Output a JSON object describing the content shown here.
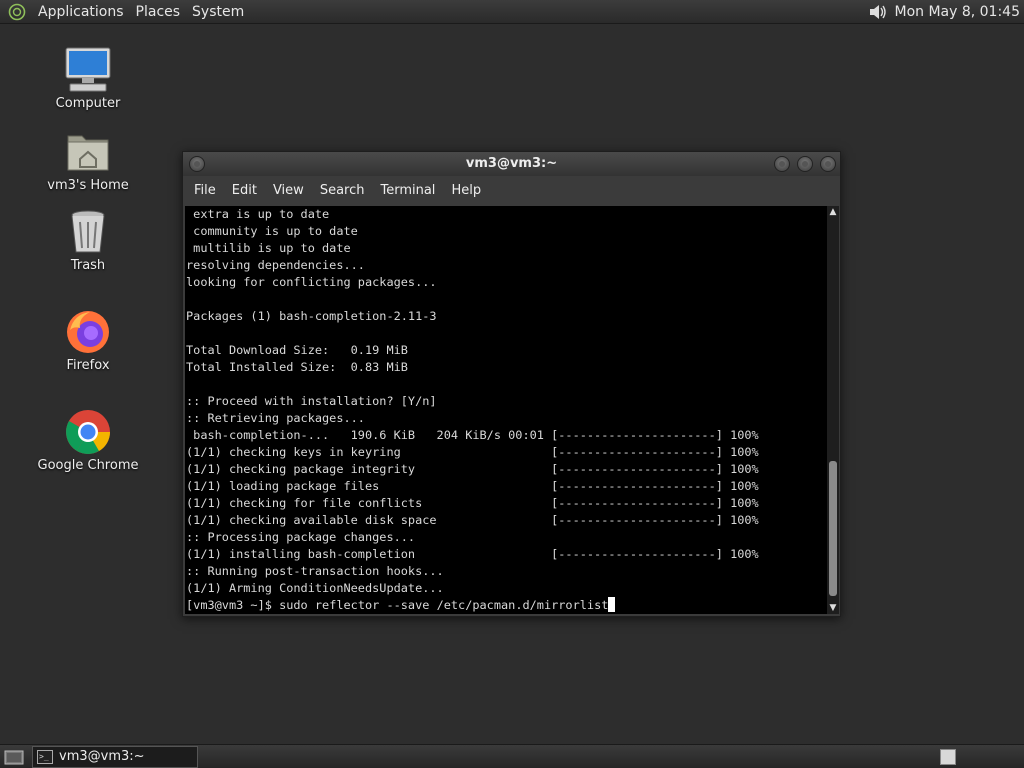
{
  "top_panel": {
    "menus": [
      "Applications",
      "Places",
      "System"
    ],
    "clock": "Mon May  8, 01:45",
    "icons": {
      "logo": "distro-logo-icon",
      "volume": "volume-icon"
    }
  },
  "desktop": {
    "icons": [
      {
        "label": "Computer",
        "icon": "computer-icon"
      },
      {
        "label": "vm3's Home",
        "icon": "home-folder-icon"
      },
      {
        "label": "Trash",
        "icon": "trash-icon"
      },
      {
        "label": "Firefox",
        "icon": "firefox-icon"
      },
      {
        "label": "Google Chrome",
        "icon": "chrome-icon"
      }
    ]
  },
  "terminal": {
    "title": "vm3@vm3:~",
    "menu": [
      "File",
      "Edit",
      "View",
      "Search",
      "Terminal",
      "Help"
    ],
    "lines": [
      " extra is up to date",
      " community is up to date",
      " multilib is up to date",
      "resolving dependencies...",
      "looking for conflicting packages...",
      "",
      "Packages (1) bash-completion-2.11-3",
      "",
      "Total Download Size:   0.19 MiB",
      "Total Installed Size:  0.83 MiB",
      "",
      ":: Proceed with installation? [Y/n]",
      ":: Retrieving packages...",
      " bash-completion-...   190.6 KiB   204 KiB/s 00:01 [----------------------] 100%",
      "(1/1) checking keys in keyring                     [----------------------] 100%",
      "(1/1) checking package integrity                   [----------------------] 100%",
      "(1/1) loading package files                        [----------------------] 100%",
      "(1/1) checking for file conflicts                  [----------------------] 100%",
      "(1/1) checking available disk space                [----------------------] 100%",
      ":: Processing package changes...",
      "(1/1) installing bash-completion                   [----------------------] 100%",
      ":: Running post-transaction hooks...",
      "(1/1) Arming ConditionNeedsUpdate..."
    ],
    "prompt": "[vm3@vm3 ~]$ ",
    "command": "sudo reflector --save /etc/pacman.d/mirrorlist"
  },
  "bottom_panel": {
    "task_title": "vm3@vm3:~",
    "icons": {
      "show_desktop": "show-desktop-icon",
      "task": "terminal-icon",
      "workspace": "workspace-switcher-icon"
    }
  }
}
